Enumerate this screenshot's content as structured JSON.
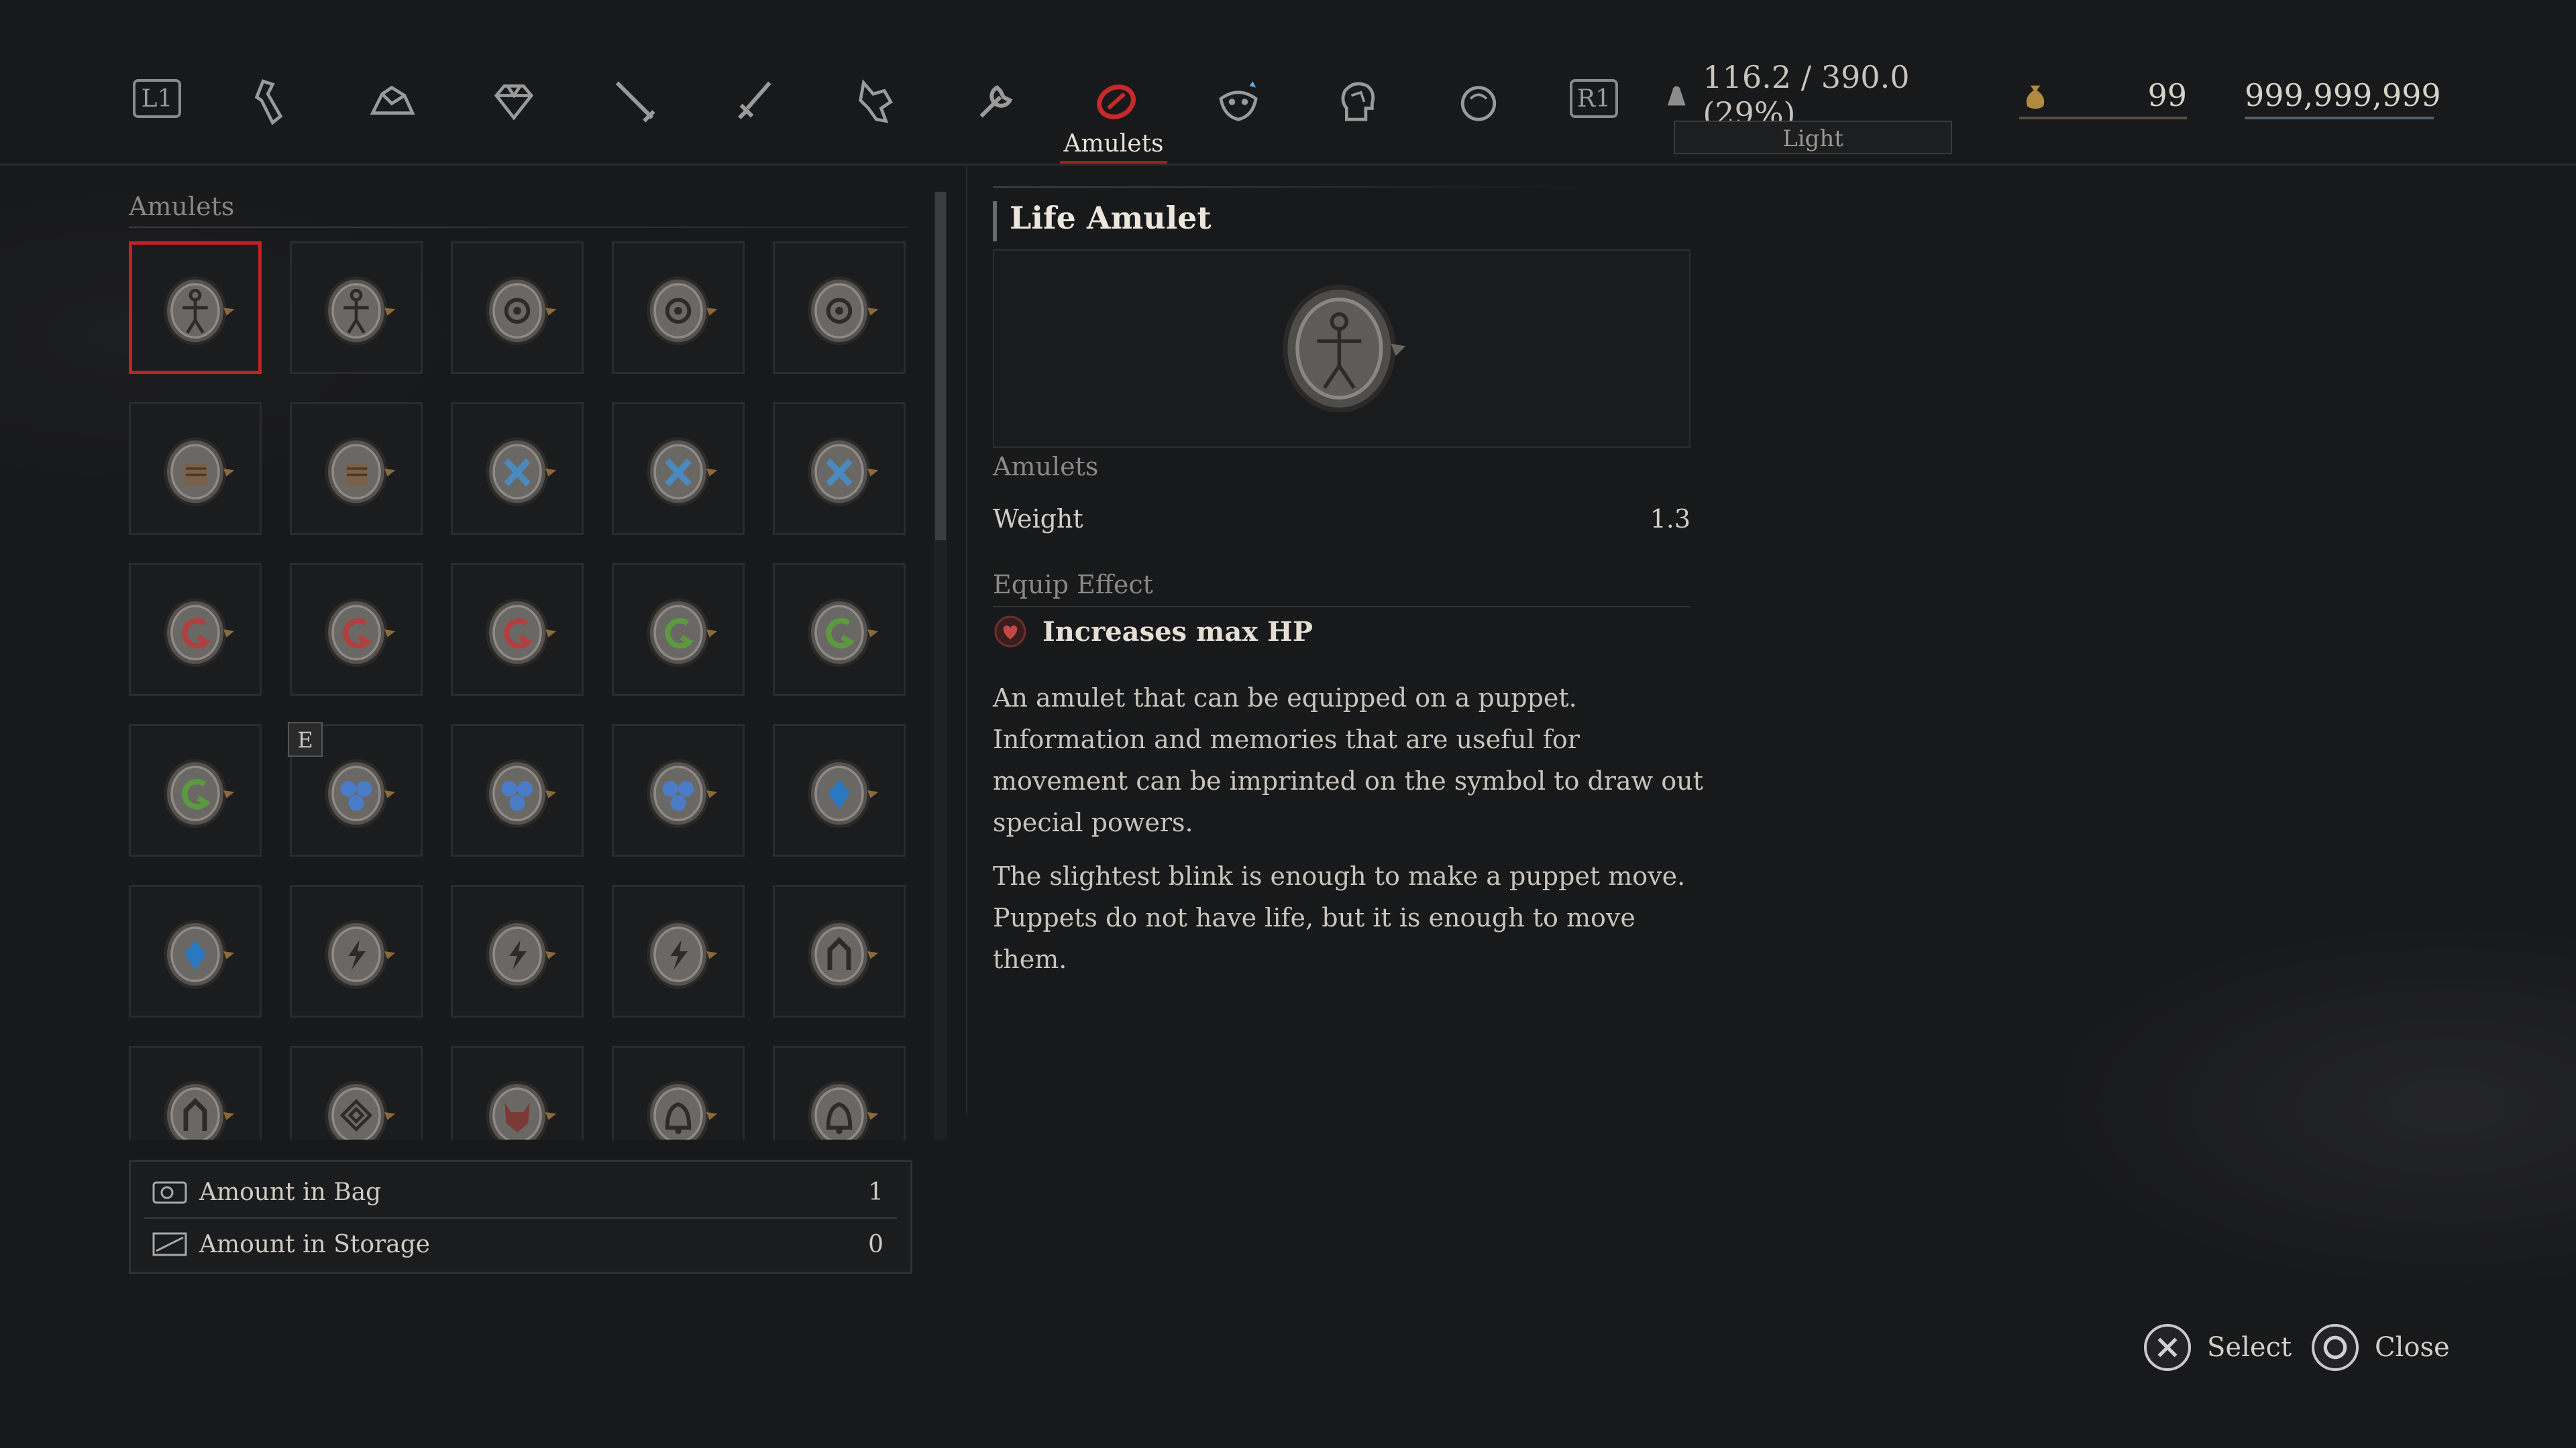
{
  "topbar": {
    "left_shoulder": "L1",
    "right_shoulder": "R1",
    "tabs": [
      {
        "id": "consumables",
        "icon": "vial-icon"
      },
      {
        "id": "materials",
        "icon": "ore-icon"
      },
      {
        "id": "valuables",
        "icon": "gem-icon"
      },
      {
        "id": "weapons",
        "icon": "sword-icon"
      },
      {
        "id": "handles",
        "icon": "hilt-icon"
      },
      {
        "id": "arms",
        "icon": "legion-arm-icon"
      },
      {
        "id": "tools",
        "icon": "wrench-icon"
      },
      {
        "id": "amulets",
        "icon": "amulet-icon",
        "active": true
      },
      {
        "id": "collectibles",
        "icon": "mask-icon"
      },
      {
        "id": "quartz",
        "icon": "head-icon"
      },
      {
        "id": "keys",
        "icon": "orb-icon"
      }
    ],
    "active_tab_label": "Amulets",
    "load": {
      "text": "116.2 / 390.0 (29%)",
      "status": "Light"
    },
    "ergo_count": "99",
    "currency": "999,999,999"
  },
  "left_panel": {
    "section_label": "Amulets",
    "slots": [
      {
        "kind": "life"
      },
      {
        "kind": "life"
      },
      {
        "kind": "ring"
      },
      {
        "kind": "ring"
      },
      {
        "kind": "ring"
      },
      {
        "kind": "fist"
      },
      {
        "kind": "fist"
      },
      {
        "kind": "blue-x"
      },
      {
        "kind": "blue-x"
      },
      {
        "kind": "blue-x"
      },
      {
        "kind": "red-swirl"
      },
      {
        "kind": "red-swirl"
      },
      {
        "kind": "red-swirl"
      },
      {
        "kind": "green-swirl"
      },
      {
        "kind": "green-swirl"
      },
      {
        "kind": "green-swirl"
      },
      {
        "kind": "blue-orbs",
        "equipped": true
      },
      {
        "kind": "blue-orbs"
      },
      {
        "kind": "blue-orbs"
      },
      {
        "kind": "blue-gem"
      },
      {
        "kind": "blue-gem"
      },
      {
        "kind": "bolt"
      },
      {
        "kind": "bolt"
      },
      {
        "kind": "bolt"
      },
      {
        "kind": "arch"
      },
      {
        "kind": "arch"
      },
      {
        "kind": "diamond"
      },
      {
        "kind": "beast"
      },
      {
        "kind": "bell"
      },
      {
        "kind": "bell"
      }
    ],
    "equipped_badge": "E",
    "amounts": {
      "bag_label": "Amount in Bag",
      "bag_value": "1",
      "storage_label": "Amount in Storage",
      "storage_value": "0"
    }
  },
  "detail": {
    "title": "Life Amulet",
    "category": "Amulets",
    "weight_label": "Weight",
    "weight_value": "1.3",
    "equip_label": "Equip Effect",
    "equip_effect": "Increases max HP",
    "description": [
      "An amulet that can be equipped on a puppet.",
      "Information and memories that are useful for movement can be imprinted on the symbol to draw out special powers.",
      "The slightest blink is enough to make a puppet move.",
      "Puppets do not have life, but it is enough to move them."
    ]
  },
  "prompts": {
    "select_label": "Select",
    "close_label": "Close"
  },
  "colors": {
    "accent_red": "#c22222",
    "background": "#18191b",
    "text": "#d8d4cc"
  }
}
